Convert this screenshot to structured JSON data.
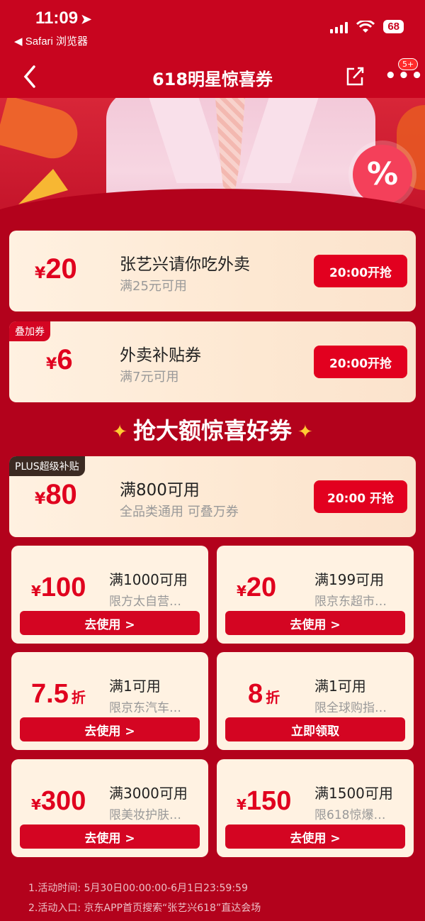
{
  "status": {
    "time": "11:09",
    "back_app": "◀ Safari 浏览器",
    "battery": "68"
  },
  "nav": {
    "title": "618明星惊喜券",
    "more": "•••",
    "badge": "5+"
  },
  "banner": {
    "badge": "%"
  },
  "coupons": [
    {
      "yen": "¥",
      "amount": "20",
      "title": "张艺兴请你吃外卖",
      "sub": "满25元可用",
      "button": "20:00开抢",
      "tag": ""
    },
    {
      "yen": "¥",
      "amount": "6",
      "title": "外卖补贴券",
      "sub": "满7元可用",
      "button": "20:00开抢",
      "tag": "叠加券"
    }
  ],
  "section_title": "抢大额惊喜好券",
  "plus_coupon": {
    "yen": "¥",
    "amount": "80",
    "title": "满800可用",
    "sub": "全品类通用 可叠万券",
    "button": "20:00 开抢",
    "tag": "PLUS超级补贴"
  },
  "grid": [
    {
      "yen": "¥",
      "amount": "100",
      "unit": "",
      "title": "满1000可用",
      "sub": "限方太自营…",
      "button": "去使用 >"
    },
    {
      "yen": "¥",
      "amount": "20",
      "unit": "",
      "title": "满199可用",
      "sub": "限京东超市…",
      "button": "去使用 >"
    },
    {
      "yen": "",
      "amount": "7.5",
      "unit": "折",
      "title": "满1可用",
      "sub": "限京东汽车…",
      "button": "去使用 >"
    },
    {
      "yen": "",
      "amount": "8",
      "unit": "折",
      "title": "满1可用",
      "sub": "限全球购指…",
      "button": "立即领取"
    },
    {
      "yen": "¥",
      "amount": "300",
      "unit": "",
      "title": "满3000可用",
      "sub": "限美妆护肤…",
      "button": "去使用 >"
    },
    {
      "yen": "¥",
      "amount": "150",
      "unit": "",
      "title": "满1500可用",
      "sub": "限618惊爆…",
      "button": "去使用 >"
    }
  ],
  "footer": {
    "line1": "1.活动时间: 5月30日00:00:00-6月1日23:59:59",
    "line2": "2.活动入口: 京东APP首页搜索“张艺兴618”直达会场"
  },
  "colors": {
    "brand_red": "#c8051f",
    "coupon_red": "#e0001e",
    "bg": "#b3021c"
  }
}
